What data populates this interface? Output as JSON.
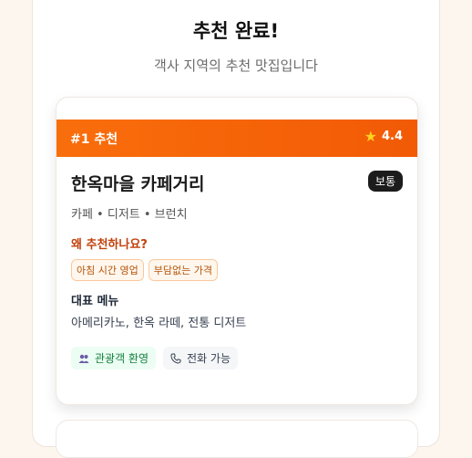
{
  "page": {
    "title": "추천 완료!",
    "subtitle": "객사 지역의 추천 맛집입니다"
  },
  "cards": [
    {
      "rank_label": "#1 추천",
      "rating": "4.4",
      "name": "한옥마을 카페거리",
      "crowd_badge": "보통",
      "category": "카페 • 디저트 • 브런치",
      "why_title": "왜 추천하나요?",
      "reasons": [
        "아침 시간 영업",
        "부담없는 가격"
      ],
      "menu_title": "대표 메뉴",
      "menu_items": "아메리카노, 한옥 라떼, 전통 디저트",
      "features": [
        {
          "label": "관광객 환영",
          "icon": "people-icon"
        },
        {
          "label": "전화 가능",
          "icon": "phone-icon"
        }
      ]
    }
  ],
  "colors": {
    "accent": "#f96e0c",
    "reason_text": "#b45309",
    "why_title": "#c2410c",
    "feature_green": "#15803d"
  }
}
